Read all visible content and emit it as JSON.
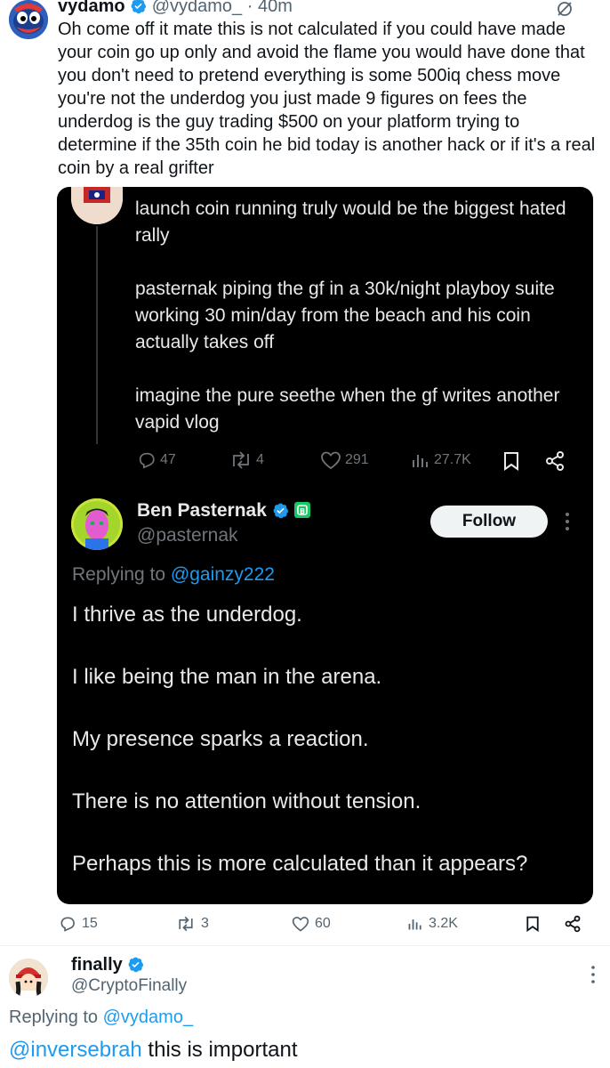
{
  "top_tweet": {
    "display_name": "vydamo",
    "handle": "@vydamo_",
    "time": "· 40m",
    "body": "Oh come off it mate this is not calculated if you could have made your coin go up only and avoid the flame you would have done that you don't need to pretend everything is some 500iq chess move you're not the underdog you just made 9 figures on fees the underdog is the guy trading $500 on your platform trying to determine if the 35th coin he bid today is another hack or if it's a real coin by a real grifter",
    "actions": {
      "replies": "15",
      "reposts": "3",
      "likes": "60",
      "views": "3.2K"
    }
  },
  "embedded": {
    "quoted_post": {
      "p1": "launch coin running truly would be the biggest hated rally",
      "p2": "pasternak piping the gf in a 30k/night playboy suite working 30 min/day from the beach and his coin actually takes off",
      "p3": "imagine the pure seethe when the gf writes another vapid vlog",
      "replies": "47",
      "reposts": "4",
      "likes": "291",
      "views": "27.7K"
    },
    "reply": {
      "display_name": "Ben Pasternak",
      "handle": "@pasternak",
      "follow_label": "Follow",
      "replying_prefix": "Replying to ",
      "replying_to": "@gainzy222",
      "lines": [
        "I thrive as the underdog.",
        "I like being the man in the arena.",
        "My presence sparks a reaction.",
        "There is no attention without tension.",
        "Perhaps this is more calculated than it appears?"
      ]
    }
  },
  "bottom_tweet": {
    "display_name": "finally",
    "handle": "@CryptoFinally",
    "replying_prefix": "Replying to ",
    "replying_to": "@vydamo_",
    "mention": "@inversebrah",
    "body": " this is important"
  },
  "colors": {
    "link": "#1d9bf0",
    "verified": "#1d9bf0",
    "text": "#0f1419",
    "muted": "#536471",
    "dark_bg": "#000000"
  }
}
